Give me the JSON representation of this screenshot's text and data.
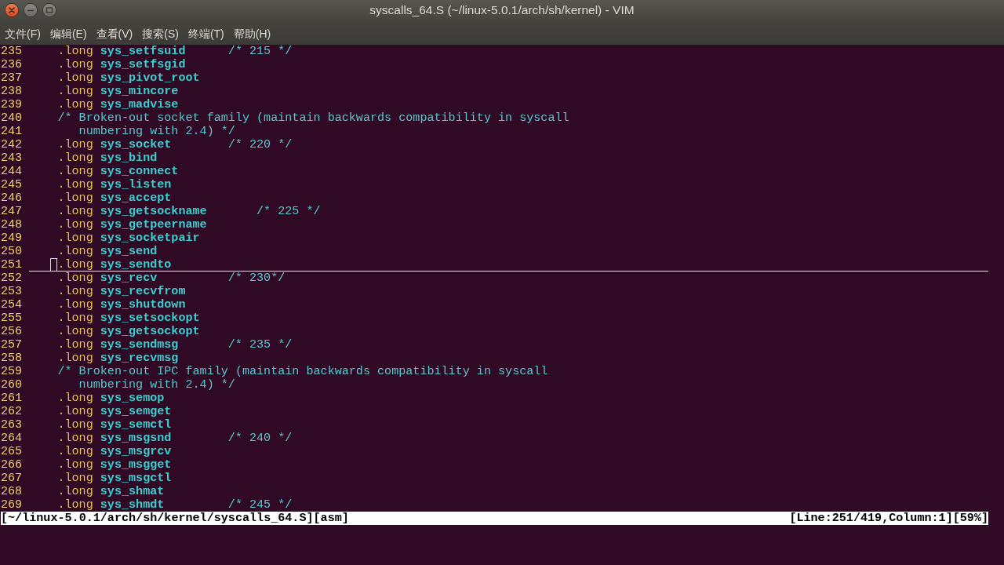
{
  "window": {
    "title": "syscalls_64.S (~/linux-5.0.1/arch/sh/kernel) - VIM"
  },
  "menu": [
    "文件(F)",
    "编辑(E)",
    "查看(V)",
    "搜索(S)",
    "终端(T)",
    "帮助(H)"
  ],
  "editor": {
    "lines": [
      {
        "number": "235",
        "kind": "instruction",
        "directive": ".long",
        "symbol": "sys_setfsuid",
        "comment": "/* 215 */",
        "current": false
      },
      {
        "number": "236",
        "kind": "instruction",
        "directive": ".long",
        "symbol": "sys_setfsgid",
        "current": false
      },
      {
        "number": "237",
        "kind": "instruction",
        "directive": ".long",
        "symbol": "sys_pivot_root",
        "current": false
      },
      {
        "number": "238",
        "kind": "instruction",
        "directive": ".long",
        "symbol": "sys_mincore",
        "current": false
      },
      {
        "number": "239",
        "kind": "instruction",
        "directive": ".long",
        "symbol": "sys_madvise",
        "current": false
      },
      {
        "number": "240",
        "kind": "comment",
        "comment": "/* Broken-out socket family (maintain backwards compatibility in syscall",
        "current": false
      },
      {
        "number": "241",
        "kind": "continuation",
        "comment": "numbering with 2.4) */",
        "current": false
      },
      {
        "number": "242",
        "kind": "instruction",
        "directive": ".long",
        "symbol": "sys_socket",
        "comment": "/* 220 */",
        "current": false
      },
      {
        "number": "243",
        "kind": "instruction",
        "directive": ".long",
        "symbol": "sys_bind",
        "current": false
      },
      {
        "number": "244",
        "kind": "instruction",
        "directive": ".long",
        "symbol": "sys_connect",
        "current": false
      },
      {
        "number": "245",
        "kind": "instruction",
        "directive": ".long",
        "symbol": "sys_listen",
        "current": false
      },
      {
        "number": "246",
        "kind": "instruction",
        "directive": ".long",
        "symbol": "sys_accept",
        "current": false
      },
      {
        "number": "247",
        "kind": "instruction",
        "directive": ".long",
        "symbol": "sys_getsockname",
        "comment": "/* 225 */",
        "current": false
      },
      {
        "number": "248",
        "kind": "instruction",
        "directive": ".long",
        "symbol": "sys_getpeername",
        "current": false
      },
      {
        "number": "249",
        "kind": "instruction",
        "directive": ".long",
        "symbol": "sys_socketpair",
        "current": false
      },
      {
        "number": "250",
        "kind": "instruction",
        "directive": ".long",
        "symbol": "sys_send",
        "current": false
      },
      {
        "number": "251",
        "kind": "instruction",
        "directive": ".long",
        "symbol": "sys_sendto",
        "current": true
      },
      {
        "number": "252",
        "kind": "instruction",
        "directive": ".long",
        "symbol": "sys_recv",
        "comment": "/* 230*/",
        "current": false
      },
      {
        "number": "253",
        "kind": "instruction",
        "directive": ".long",
        "symbol": "sys_recvfrom",
        "current": false
      },
      {
        "number": "254",
        "kind": "instruction",
        "directive": ".long",
        "symbol": "sys_shutdown",
        "current": false
      },
      {
        "number": "255",
        "kind": "instruction",
        "directive": ".long",
        "symbol": "sys_setsockopt",
        "current": false
      },
      {
        "number": "256",
        "kind": "instruction",
        "directive": ".long",
        "symbol": "sys_getsockopt",
        "current": false
      },
      {
        "number": "257",
        "kind": "instruction",
        "directive": ".long",
        "symbol": "sys_sendmsg",
        "comment": "/* 235 */",
        "current": false
      },
      {
        "number": "258",
        "kind": "instruction",
        "directive": ".long",
        "symbol": "sys_recvmsg",
        "current": false
      },
      {
        "number": "259",
        "kind": "comment",
        "comment": "/* Broken-out IPC family (maintain backwards compatibility in syscall",
        "current": false
      },
      {
        "number": "260",
        "kind": "continuation",
        "comment": "numbering with 2.4) */",
        "current": false
      },
      {
        "number": "261",
        "kind": "instruction",
        "directive": ".long",
        "symbol": "sys_semop",
        "current": false
      },
      {
        "number": "262",
        "kind": "instruction",
        "directive": ".long",
        "symbol": "sys_semget",
        "current": false
      },
      {
        "number": "263",
        "kind": "instruction",
        "directive": ".long",
        "symbol": "sys_semctl",
        "current": false
      },
      {
        "number": "264",
        "kind": "instruction",
        "directive": ".long",
        "symbol": "sys_msgsnd",
        "comment": "/* 240 */",
        "current": false
      },
      {
        "number": "265",
        "kind": "instruction",
        "directive": ".long",
        "symbol": "sys_msgrcv",
        "current": false
      },
      {
        "number": "266",
        "kind": "instruction",
        "directive": ".long",
        "symbol": "sys_msgget",
        "current": false
      },
      {
        "number": "267",
        "kind": "instruction",
        "directive": ".long",
        "symbol": "sys_msgctl",
        "current": false
      },
      {
        "number": "268",
        "kind": "instruction",
        "directive": ".long",
        "symbol": "sys_shmat",
        "current": false
      },
      {
        "number": "269",
        "kind": "instruction",
        "directive": ".long",
        "symbol": "sys_shmdt",
        "comment": "/* 245 */",
        "current": false
      }
    ],
    "status_line": {
      "file": "[~/linux-5.0.1/arch/sh/kernel/syscalls_64.S][asm]",
      "position": "[Line:251/419,Column:1][59%]"
    }
  }
}
